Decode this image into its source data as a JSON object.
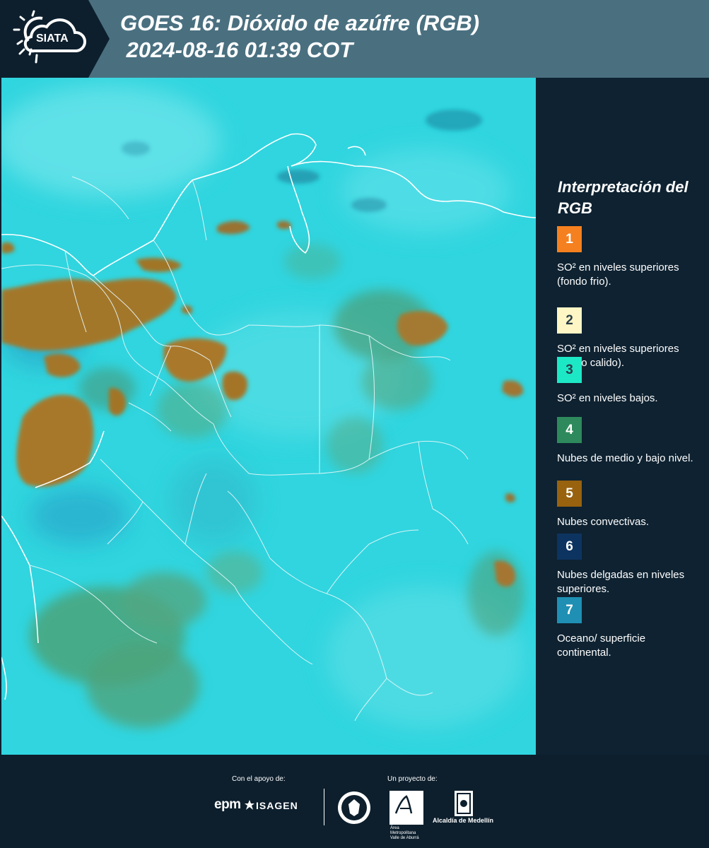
{
  "header": {
    "logo_text": "SIATA",
    "title_line1": "GOES 16: Dióxido de azúfre (RGB)",
    "title_line2": " 2024-08-16 01:39 COT"
  },
  "legend": {
    "title": "Interpretación del RGB",
    "items": [
      {
        "num": "1",
        "color": "#f5801f",
        "label": "SO² en niveles superiores (fondo frio)."
      },
      {
        "num": "2",
        "color": "#fef6c4",
        "label": "SO² en niveles superiores (fondo calido)."
      },
      {
        "num": "3",
        "color": "#1de8c6",
        "label": "SO² en niveles bajos."
      },
      {
        "num": "4",
        "color": "#2e8a5c",
        "label": "Nubes de medio y bajo nivel."
      },
      {
        "num": "5",
        "color": "#98620f",
        "label": "Nubes convectivas."
      },
      {
        "num": "6",
        "color": "#0d3460",
        "label": "Nubes delgadas en niveles superiores."
      },
      {
        "num": "7",
        "color": "#1f90b4",
        "label": "Oceano/ superficie continental."
      }
    ]
  },
  "footer": {
    "support_label": "Con el apoyo de:",
    "project_label": "Un proyecto de:",
    "sponsors": [
      "epm",
      "ISAGEN"
    ],
    "partners": [
      "Área Metropolitana Valle de Aburrá",
      "Alcaldía de Medellín"
    ]
  },
  "colors": {
    "header_bg": "#4a7080",
    "panel_bg": "#0e2231",
    "map_cyan": "#2bd3df",
    "cloud_brown": "#a27a2a",
    "cloud_green": "#4a9a6a"
  }
}
